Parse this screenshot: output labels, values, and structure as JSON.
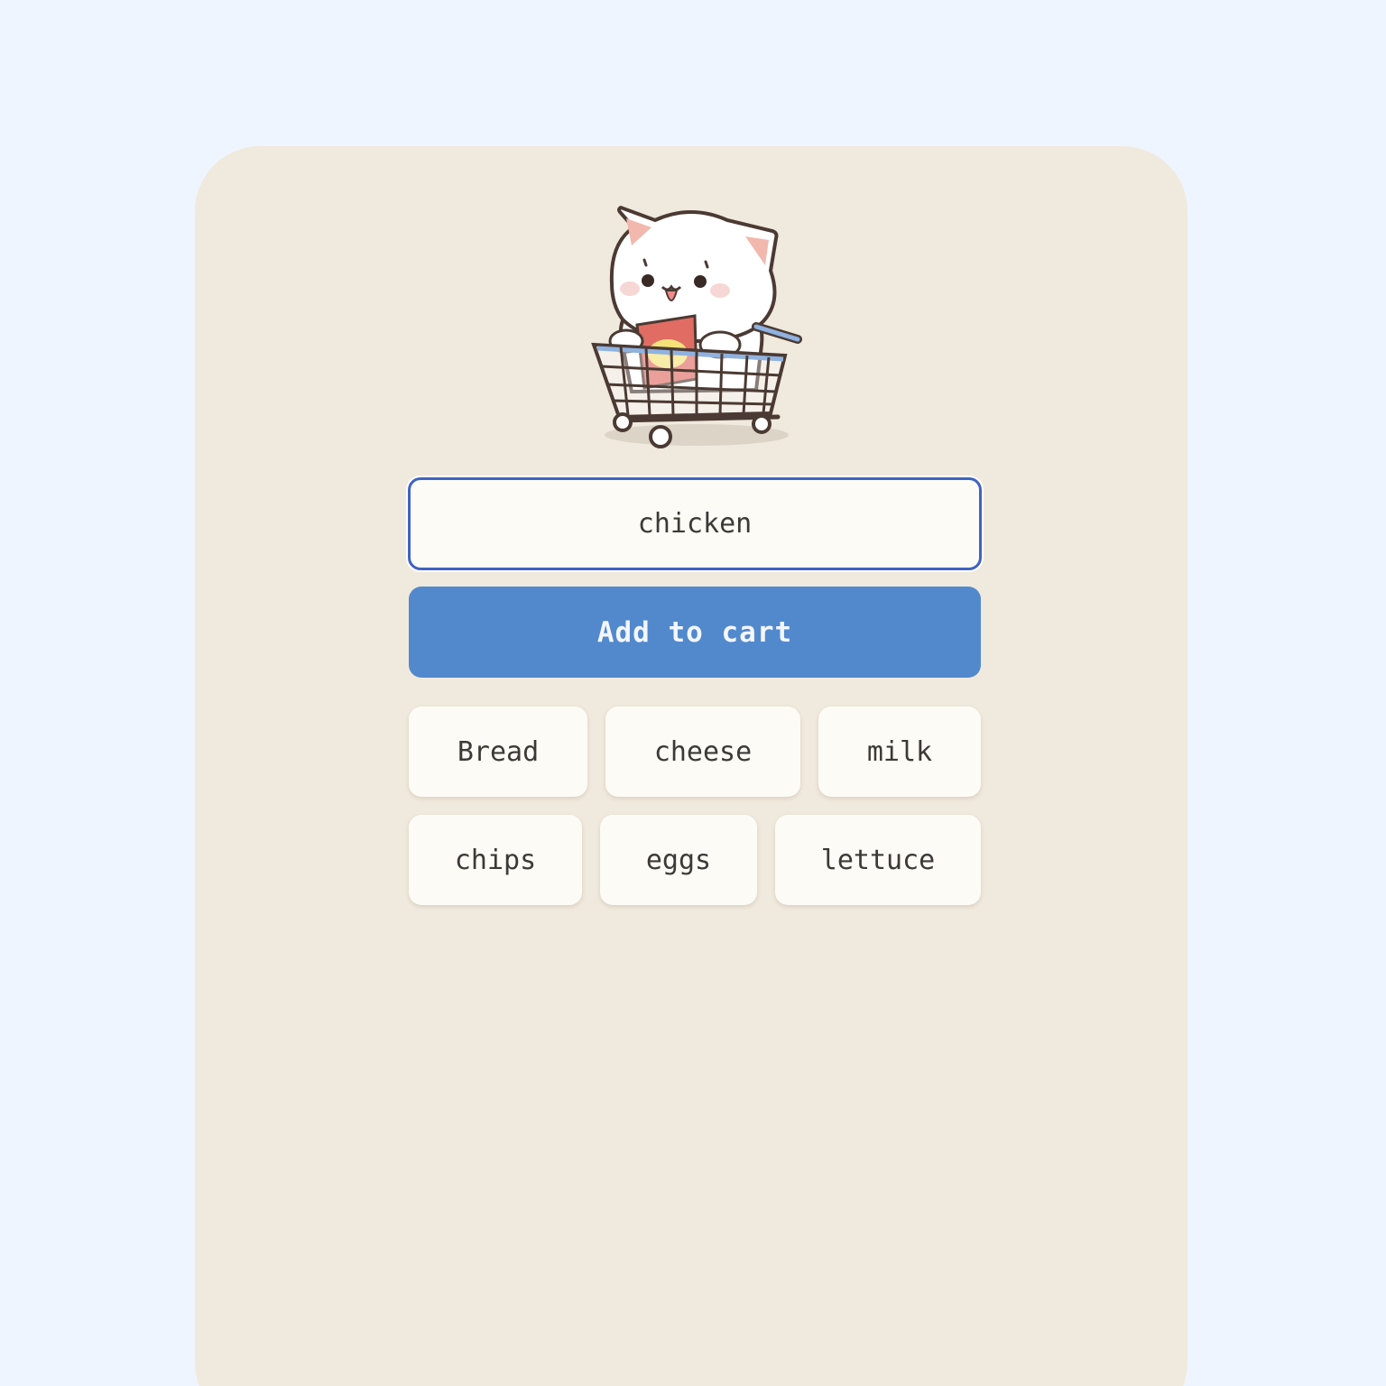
{
  "input": {
    "value": "chicken"
  },
  "add_button": {
    "label": "Add to cart"
  },
  "suggestions": [
    "Bread",
    "cheese",
    "milk",
    "chips",
    "eggs",
    "lettuce"
  ],
  "mascot": {
    "icon": "cat-in-shopping-cart-icon"
  },
  "colors": {
    "page_background": "#eff5fe",
    "card_background": "#f0e9dd",
    "accent": "#5289cd",
    "input_border": "#3f63c2",
    "chip_background": "#fcfbf6",
    "text": "#3d3935"
  }
}
